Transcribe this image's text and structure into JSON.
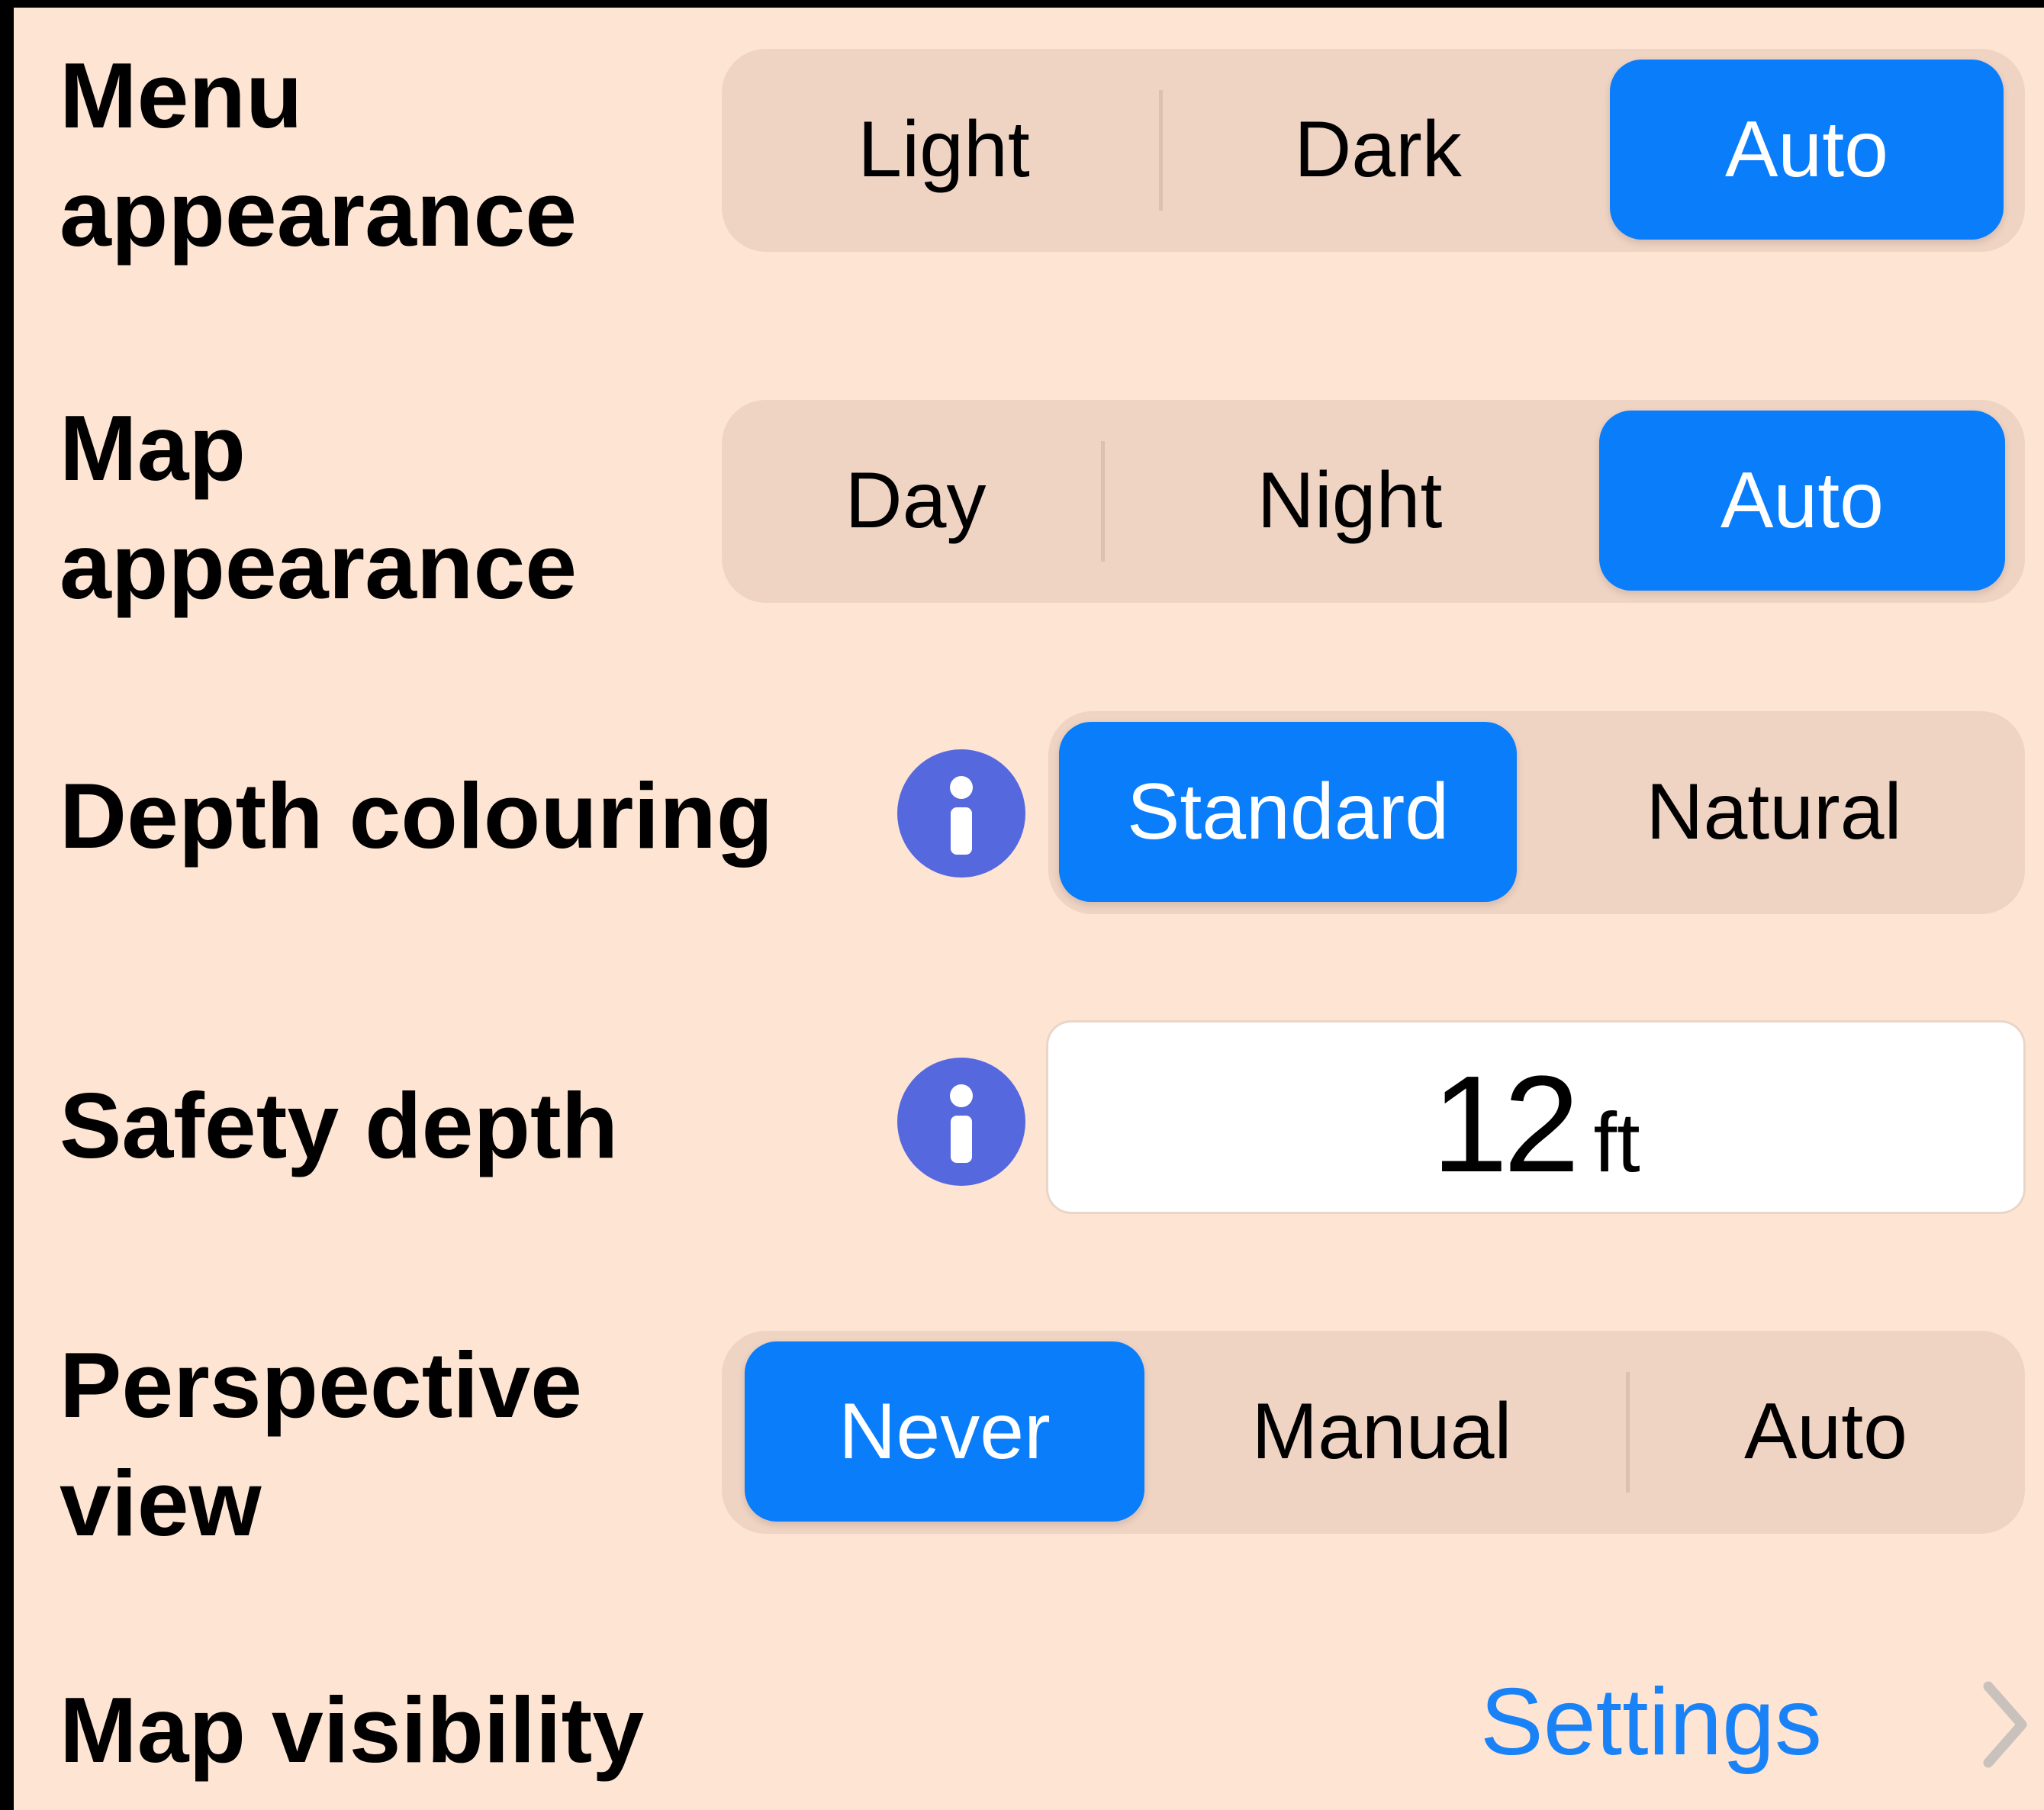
{
  "rows": {
    "menu_appearance": {
      "label_line1": "Menu",
      "label_line2": "appearance",
      "options": [
        "Light",
        "Dark",
        "Auto"
      ],
      "selected": "Auto"
    },
    "map_appearance": {
      "label_line1": "Map",
      "label_line2": "appearance",
      "options": [
        "Day",
        "Night",
        "Auto"
      ],
      "selected": "Auto"
    },
    "depth_colouring": {
      "label": "Depth colouring",
      "info_icon": "info-circle-icon",
      "options": [
        "Standard",
        "Natural"
      ],
      "selected": "Standard"
    },
    "safety_depth": {
      "label": "Safety depth",
      "info_icon": "info-circle-icon",
      "value": "12",
      "unit": "ft"
    },
    "perspective_view": {
      "label_line1": "Perspective",
      "label_line2": "view",
      "options": [
        "Never",
        "Manual",
        "Auto"
      ],
      "selected": "Never"
    },
    "map_visibility": {
      "label": "Map visibility",
      "link": "Settings",
      "link_icon": "chevron-right-icon"
    }
  },
  "colors": {
    "background": "#fde4d3",
    "segment_track": "#efd3c3",
    "selected": "#0a7dfb",
    "info_icon": "#5668de",
    "link": "#1a82f7",
    "chevron": "#c9c1bb"
  }
}
